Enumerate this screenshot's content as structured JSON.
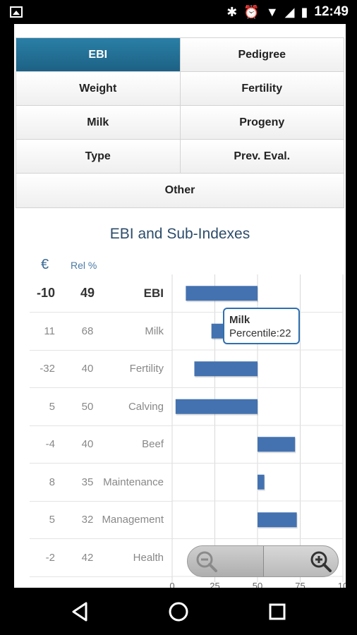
{
  "status": {
    "time": "12:49"
  },
  "tabs": {
    "rows": [
      [
        "EBI",
        "Pedigree"
      ],
      [
        "Weight",
        "Fertility"
      ],
      [
        "Milk",
        "Progeny"
      ],
      [
        "Type",
        "Prev. Eval."
      ],
      [
        "Other"
      ]
    ],
    "active": "EBI"
  },
  "chart_data": {
    "type": "bar",
    "title": "EBI and Sub-Indexes",
    "columns": {
      "euro": "€",
      "rel": "Rel %"
    },
    "categories": [
      "EBI",
      "Milk",
      "Fertility",
      "Calving",
      "Beef",
      "Maintenance",
      "Management",
      "Health"
    ],
    "euro": [
      "-10",
      "11",
      "-32",
      "5",
      "-4",
      "8",
      "5",
      "-2"
    ],
    "rel": [
      "49",
      "68",
      "40",
      "50",
      "40",
      "35",
      "32",
      "42"
    ],
    "ranges": [
      [
        8,
        50
      ],
      [
        23,
        50
      ],
      [
        13,
        50
      ],
      [
        2,
        50
      ],
      [
        50,
        72
      ],
      [
        50,
        54
      ],
      [
        50,
        73
      ],
      [
        50,
        60
      ]
    ],
    "x_ticks": [
      "0",
      "25",
      "50",
      "75",
      "10"
    ],
    "xlim": [
      0,
      100
    ],
    "bar_color": "#4472b0",
    "tooltip": {
      "title": "Milk",
      "text": "Percentile:22"
    }
  },
  "zoom": {
    "out_label": "zoom-out",
    "in_label": "zoom-in"
  }
}
